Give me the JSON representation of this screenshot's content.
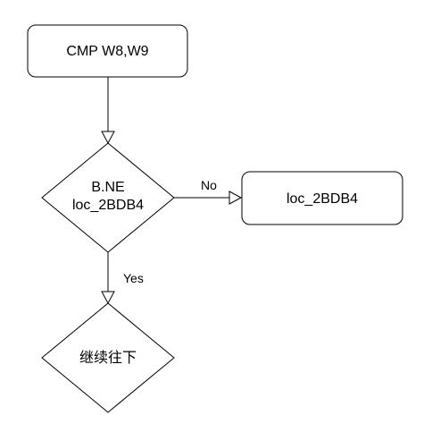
{
  "diagram": {
    "nodes": {
      "compare": {
        "label": "CMP W8,W9"
      },
      "branch": {
        "line1": "B.NE",
        "line2": "loc_2BDB4"
      },
      "target": {
        "label": "loc_2BDB4"
      },
      "continue": {
        "label": "继续往下"
      }
    },
    "edges": {
      "no_label": "No",
      "yes_label": "Yes"
    },
    "colors": {
      "stroke": "#000000",
      "fill": "#ffffff",
      "text": "#000000"
    }
  }
}
